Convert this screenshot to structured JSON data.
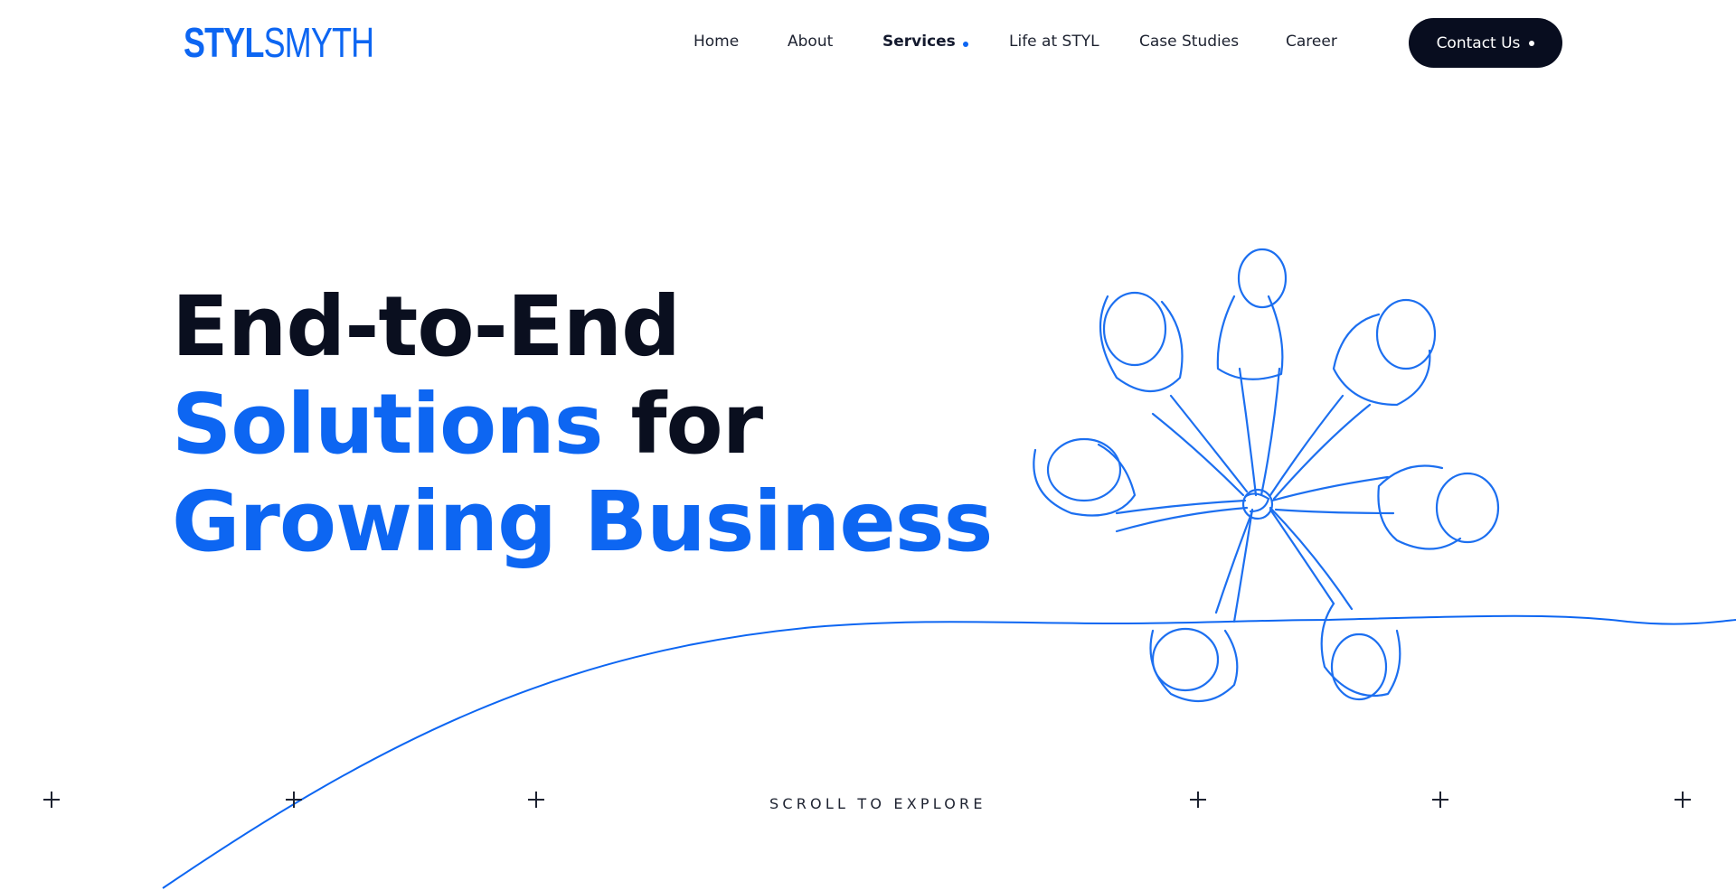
{
  "header": {
    "logo": {
      "part1": "STYL",
      "part2": "SMYTH"
    },
    "nav": [
      {
        "label": "Home",
        "active": false
      },
      {
        "label": "About",
        "active": false
      },
      {
        "label": "Services",
        "active": true
      },
      {
        "label": "Life at STYL",
        "active": false
      },
      {
        "label": "Case Studies",
        "active": false
      },
      {
        "label": "Career",
        "active": false
      }
    ],
    "contact_label": "Contact Us"
  },
  "hero": {
    "line1": "End-to-End",
    "line2_blue": "Solutions",
    "line2_rest": "for",
    "line3": "Growing Business",
    "illustration": "team-huddle-line-art"
  },
  "scroll": {
    "label": "SCROLL TO EXPLORE"
  },
  "colors": {
    "accent": "#0d66f2",
    "dark": "#080d1f",
    "text": "#1d2230"
  }
}
